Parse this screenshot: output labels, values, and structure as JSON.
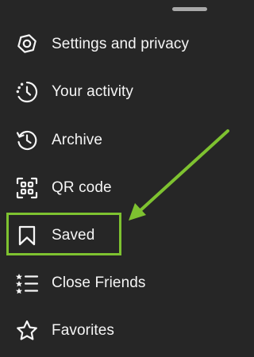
{
  "menu": {
    "items": [
      {
        "label": "Settings and privacy",
        "icon": "gear-icon"
      },
      {
        "label": "Your activity",
        "icon": "activity-clock-icon"
      },
      {
        "label": "Archive",
        "icon": "archive-history-icon"
      },
      {
        "label": "QR code",
        "icon": "qr-code-icon"
      },
      {
        "label": "Saved",
        "icon": "bookmark-icon"
      },
      {
        "label": "Close Friends",
        "icon": "close-friends-list-icon"
      },
      {
        "label": "Favorites",
        "icon": "star-icon"
      }
    ]
  },
  "annotation": {
    "highlight_color": "#7ec230",
    "highlighted_item": "Saved"
  }
}
